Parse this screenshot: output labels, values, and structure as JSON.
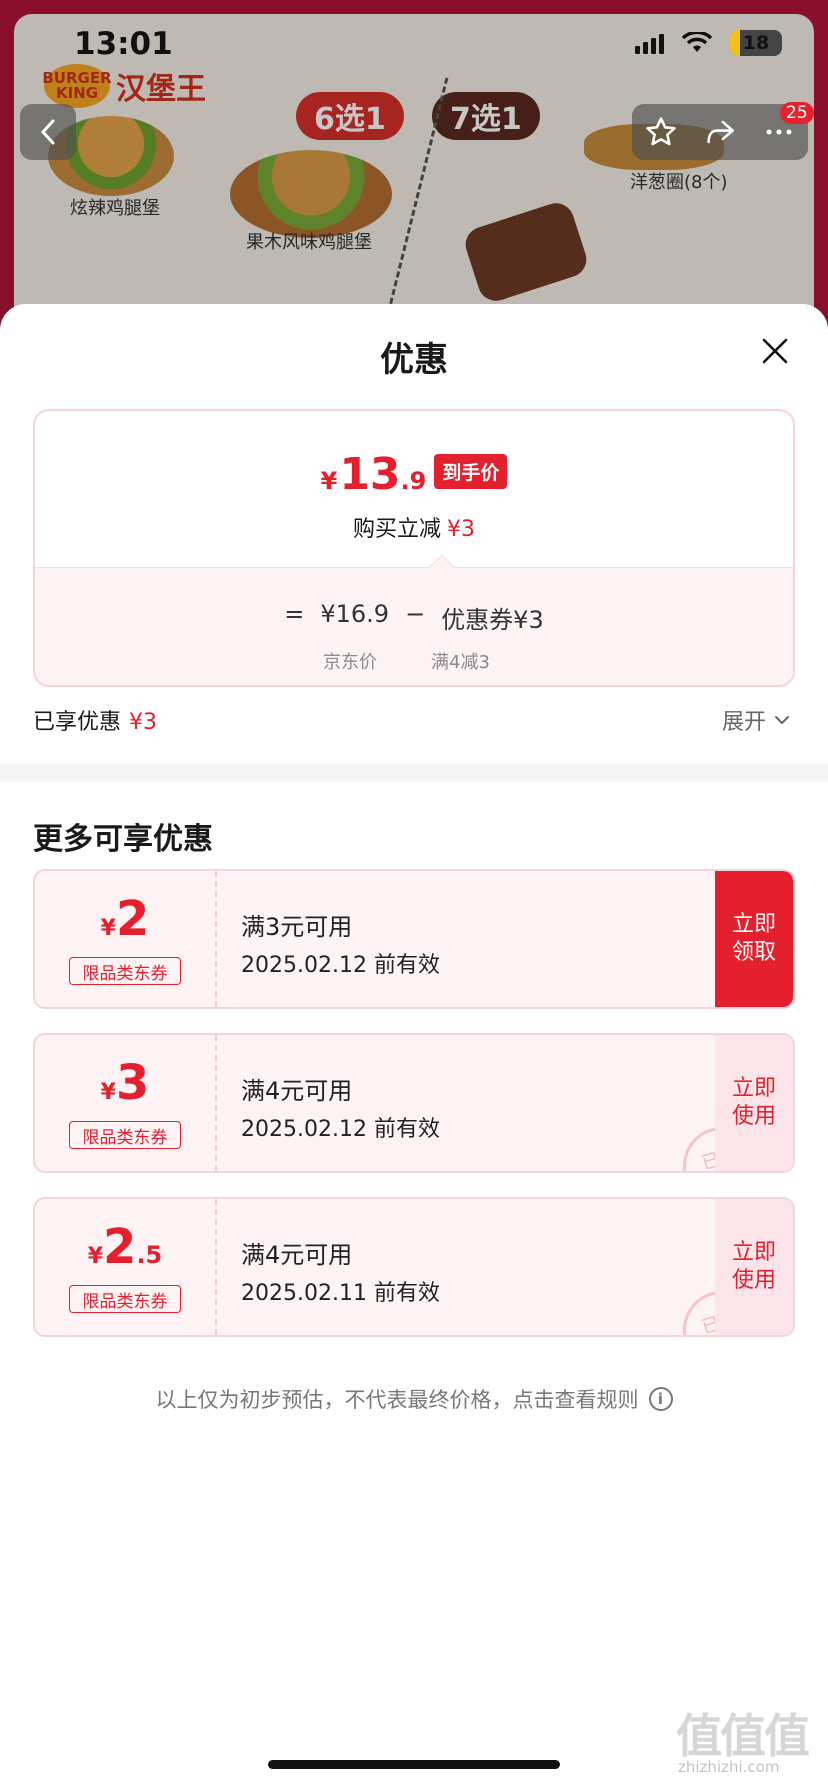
{
  "status_bar": {
    "time": "13:01",
    "battery": "18"
  },
  "background": {
    "brand_logo_line1": "BURGER",
    "brand_logo_line2": "KING",
    "brand_name": "汉堡王",
    "choice_a": "6选1",
    "choice_b": "7选1",
    "food_1": "炫辣鸡腿堡",
    "food_2": "果木风味鸡腿堡",
    "food_3": "洋葱圈(8个)",
    "cart_count": "25"
  },
  "sheet": {
    "title": "优惠",
    "final_price": {
      "yen": "¥",
      "int": "13",
      "dec": ".9",
      "tag": "到手价"
    },
    "instant_discount": {
      "label": "购买立减",
      "amount": "¥3"
    },
    "formula": {
      "eq": "=",
      "jd_price": "¥16.9",
      "minus": "−",
      "coupon": "优惠券¥3",
      "jd_price_label": "京东价",
      "coupon_label": "满4减3"
    },
    "enjoyed": {
      "label": "已享优惠",
      "amount": "¥3"
    },
    "expand_label": "展开",
    "more_title": "更多可享优惠",
    "coupons": [
      {
        "yen": "¥",
        "int": "2",
        "dec": "",
        "type": "限品类东券",
        "cond": "满3元可用",
        "date": "2025.02.12 前有效",
        "action": "立即 领取",
        "state": "claim"
      },
      {
        "yen": "¥",
        "int": "3",
        "dec": "",
        "type": "限品类东券",
        "cond": "满4元可用",
        "date": "2025.02.12 前有效",
        "action": "立即 使用",
        "state": "use",
        "stamp": "已领"
      },
      {
        "yen": "¥",
        "int": "2",
        "dec": ".5",
        "type": "限品类东券",
        "cond": "满4元可用",
        "date": "2025.02.11 前有效",
        "action": "立即 使用",
        "state": "use",
        "stamp": "已领"
      }
    ],
    "footnote": "以上仅为初步预估，不代表最终价格，点击查看规则"
  },
  "watermark": {
    "main": "值值值",
    "sub": "zhizhizhi.com"
  },
  "colors": {
    "accent": "#e4202e",
    "coupon_bg": "#fdf3f5",
    "coupon_border": "#f5d3da"
  }
}
